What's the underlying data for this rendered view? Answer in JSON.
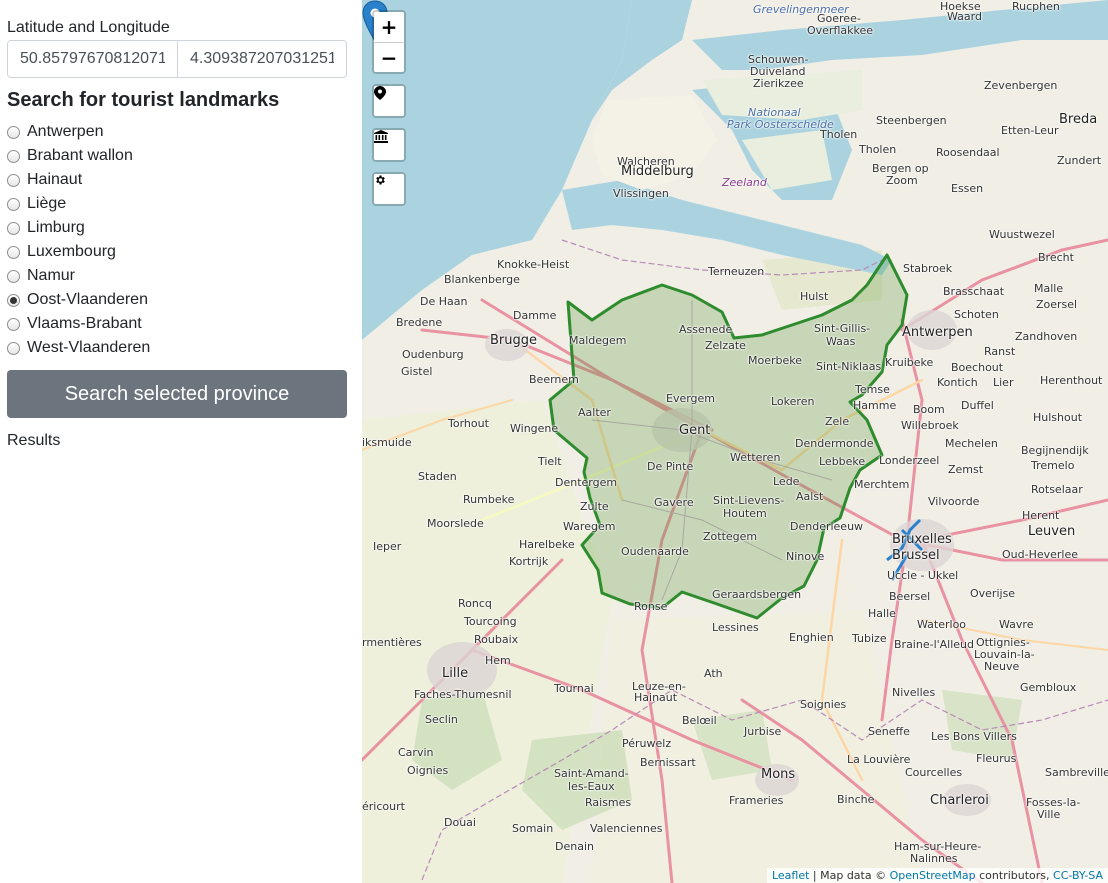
{
  "sidebar": {
    "coord_label": "Latitude and Longitude",
    "latitude": "50.85797670812071",
    "longitude": "4.309387207031251",
    "search_heading": "Search for tourist landmarks",
    "provinces": [
      {
        "label": "Antwerpen",
        "checked": false
      },
      {
        "label": "Brabant wallon",
        "checked": false
      },
      {
        "label": "Hainaut",
        "checked": false
      },
      {
        "label": "Liège",
        "checked": false
      },
      {
        "label": "Limburg",
        "checked": false
      },
      {
        "label": "Luxembourg",
        "checked": false
      },
      {
        "label": "Namur",
        "checked": false
      },
      {
        "label": "Oost-Vlaanderen",
        "checked": true
      },
      {
        "label": "Vlaams-Brabant",
        "checked": false
      },
      {
        "label": "West-Vlaanderen",
        "checked": false
      }
    ],
    "search_button": "Search selected province",
    "results_label": "Results"
  },
  "map": {
    "controls": {
      "zoom_in": "+",
      "zoom_out": "−",
      "marker_icon": "map-marker-icon",
      "landmark_icon": "landmark-icon",
      "settings_icon": "gear-icon"
    },
    "highlight_color": "#2e8b2e",
    "marker_color": "#2a81cb",
    "attribution": {
      "leaflet": "Leaflet",
      "separator": " | Map data © ",
      "osm": "OpenStreetMap",
      "contributors": " contributors, ",
      "license": "CC-BY-SA"
    },
    "labels": {
      "grevelingenmeer": "Grevelingenmeer",
      "goeree": "Goeree-",
      "overflakkee": "Overflakkee",
      "hoekse": "Hoekse",
      "waard": "Waard",
      "zevenbergen": "Zevenbergen",
      "schouwen": "Schouwen-",
      "duiveland": "Duiveland",
      "zierikzee": "Zierikzee",
      "nationaal": "Nationaal",
      "park_oosterschelde": "Park Oosterschelde",
      "tholen_island": "Tholen",
      "steenbergen": "Steenbergen",
      "breda": "Breda",
      "etten_leur": "Etten-Leur",
      "roosendaal": "Roosendaal",
      "tholen": "Tholen",
      "bergen_op_zoom_1": "Bergen op",
      "bergen_op_zoom_2": "Zoom",
      "walcheren": "Walcheren",
      "middelburg": "Middelburg",
      "zeeland": "Zeeland",
      "vlissingen": "Vlissingen",
      "essen": "Essen",
      "wuustwezel": "Wuustwezel",
      "brecht": "Brecht",
      "knokke_heist": "Knokke-Heist",
      "blankenberge": "Blankenberge",
      "terneuzen": "Terneuzen",
      "stabroek": "Stabroek",
      "brasschaat": "Brasschaat",
      "malle": "Malle",
      "zoersel": "Zoersel",
      "de_haan": "De Haan",
      "hulst": "Hulst",
      "schoten": "Schoten",
      "damme": "Damme",
      "bredene": "Bredene",
      "assenede": "Assenede",
      "sint_gillis_waas_1": "Sint-Gillis-",
      "sint_gillis_waas_2": "Waas",
      "antwerpen": "Antwerpen",
      "zandhoven": "Zandhoven",
      "maldegem": "Maldegem",
      "zelzate": "Zelzate",
      "brugge": "Brugge",
      "moerbeke": "Moerbeke",
      "ranst": "Ranst",
      "oudenburg": "Oudenburg",
      "sint_niklaas": "Sint-Niklaas",
      "kruibeke": "Kruibeke",
      "boechout": "Boechout",
      "gistel": "Gistel",
      "beernem": "Beernem",
      "temse": "Temse",
      "kontich": "Kontich",
      "lier": "Lier",
      "herenthout": "Herenthout",
      "evergem": "Evergem",
      "lokeren": "Lokeren",
      "hamme": "Hamme",
      "duffel": "Duffel",
      "aalter": "Aalter",
      "boom": "Boom",
      "torhout": "Torhout",
      "wingene": "Wingene",
      "gent": "Gent",
      "zele": "Zele",
      "willebroek": "Willebroek",
      "hulshout": "Hulshout",
      "diksmuide": "iksmuide",
      "dendermonde": "Dendermonde",
      "mechelen": "Mechelen",
      "begijnendijk": "Begijnendijk",
      "tielt": "Tielt",
      "de_pinte": "De Pinte",
      "wetteren": "Wetteren",
      "lebbeke": "Lebbeke",
      "londerzeel": "Londerzeel",
      "zemst": "Zemst",
      "tremelo": "Tremelo",
      "staden": "Staden",
      "dentergem": "Dentergem",
      "lede": "Lede",
      "merchtem": "Merchtem",
      "rotselaar": "Rotselaar",
      "rumbeke": "Rumbeke",
      "gavere": "Gavere",
      "sint_lievens_1": "Sint-Lievens-",
      "sint_lievens_2": "Houtem",
      "aalst": "Aalst",
      "vilvoorde": "Vilvoorde",
      "zulte": "Zulte",
      "moorslede": "Moorslede",
      "waregem": "Waregem",
      "denderleeuw": "Denderleeuw",
      "herent": "Herent",
      "leuven": "Leuven",
      "zottegem": "Zottegem",
      "ieper": "Ieper",
      "harelbeke": "Harelbeke",
      "oudenaarde": "Oudenaarde",
      "bruxelles": "Bruxelles",
      "brussel": "Brussel",
      "oud_heverlee": "Oud-Heverlee",
      "kortrijk": "Kortrijk",
      "ninove": "Ninove",
      "uccle": "Uccle - Ukkel",
      "beersel": "Beersel",
      "overijse": "Overijse",
      "geraardsbergen": "Geraardsbergen",
      "ronse": "Ronse",
      "roncq": "Roncq",
      "tourcoing": "Tourcoing",
      "lessines": "Lessines",
      "halle": "Halle",
      "waterloo": "Waterloo",
      "wavre": "Wavre",
      "armentieres": "rmentières",
      "roubaix": "Roubaix",
      "enghien": "Enghien",
      "tubize": "Tubize",
      "braine": "Braine-l'Alleud",
      "ottignies_1": "Ottignies-",
      "ottignies_2": "Louvain-la-",
      "ottignies_3": "Neuve",
      "hem": "Hem",
      "lille": "Lille",
      "ath": "Ath",
      "faches": "Faches-Thumesnil",
      "tournai": "Tournai",
      "leuze_1": "Leuze-en-",
      "leuze_2": "Hainaut",
      "nivelles": "Nivelles",
      "soignies": "Soignies",
      "gembloux": "Gembloux",
      "seclin": "Seclin",
      "beloeil": "Belœil",
      "jurbise": "Jurbise",
      "seneffe": "Seneffe",
      "les_bons_villers": "Les Bons Villers",
      "carvin": "Carvin",
      "peruwelz": "Péruwelz",
      "fleurus": "Fleurus",
      "bernissart": "Bernissart",
      "la_louviere": "La Louvière",
      "oignies": "Oignies",
      "saint_amand_1": "Saint-Amand-",
      "saint_amand_2": "les-Eaux",
      "mons": "Mons",
      "courcelles": "Courcelles",
      "sambreville": "Sambreville",
      "hericourt": "éricourt",
      "raismes": "Raismes",
      "frameries": "Frameries",
      "binche": "Binche",
      "charleroi": "Charleroi",
      "fosses_1": "Fosses-la-",
      "fosses_2": "Ville",
      "douai": "Douai",
      "somain": "Somain",
      "valenciennes": "Valenciennes",
      "denain": "Denain",
      "ham_sur_heure": "Ham-sur-Heure-",
      "nalinnes": "Nalinnes",
      "zundert": "Zundert",
      "rucphen": "Rucphen"
    }
  }
}
